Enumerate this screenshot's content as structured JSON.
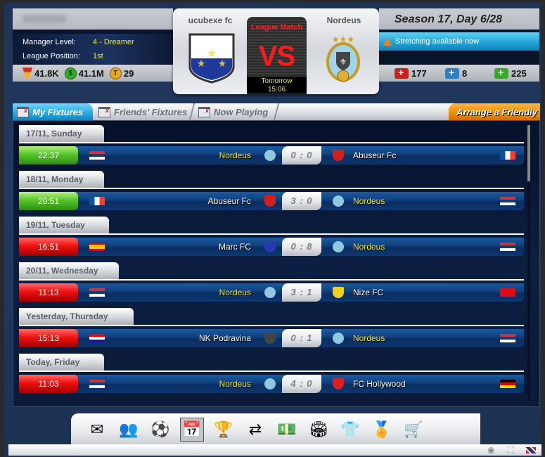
{
  "manager": {
    "name_blurred": true,
    "level_label": "Manager Level:",
    "level_value": "4 - Dreamer",
    "position_label": "League Position:",
    "position_value": "1st",
    "currencies": [
      {
        "icon": "trophy-points-icon",
        "value": "41.8K"
      },
      {
        "icon": "money-icon",
        "value": "41.1M"
      },
      {
        "icon": "token-icon",
        "value": "29"
      }
    ]
  },
  "next_match": {
    "home_team": "ucubexe fc",
    "away_team": "Nordeus",
    "type": "League Match",
    "vs": "VS",
    "day": "Tomorrow",
    "time": "15:06"
  },
  "season": {
    "label": "Season 17, Day 6/28",
    "notice": "Stretching available now",
    "kits": [
      {
        "icon": "red-medkit-icon",
        "value": "177",
        "color": "#c8201c"
      },
      {
        "icon": "blue-medkit-icon",
        "value": "8",
        "color": "#2a7fc8"
      },
      {
        "icon": "green-medkit-icon",
        "value": "225",
        "color": "#3aa72a"
      }
    ]
  },
  "tabs": [
    {
      "label": "My Fixtures",
      "active": true
    },
    {
      "label": "Friends' Fixtures",
      "active": false
    },
    {
      "label": "Now Playing",
      "active": false
    }
  ],
  "arrange_friendly": "Arrange a Friendly",
  "fixtures": [
    {
      "date": "17/11, Sunday",
      "time": "22:37",
      "result": "win",
      "home": "Nordeus",
      "home_flag": "serbia",
      "home_me": true,
      "score": "0 : 0",
      "away": "Abuseur Fc",
      "away_flag": "france",
      "away_me": false
    },
    {
      "date": "18/11, Monday",
      "time": "20:51",
      "result": "win",
      "home": "Abuseur Fc",
      "home_flag": "france",
      "home_me": false,
      "score": "3 : 0",
      "away": "Nordeus",
      "away_flag": "serbia",
      "away_me": true
    },
    {
      "date": "19/11, Tuesday",
      "time": "16:51",
      "result": "loss",
      "home": "Marc FC",
      "home_flag": "spain",
      "home_me": false,
      "score": "0 : 8",
      "away": "Nordeus",
      "away_flag": "serbia",
      "away_me": true
    },
    {
      "date": "20/11, Wednesday",
      "time": "11:13",
      "result": "loss",
      "home": "Nordeus",
      "home_flag": "serbia",
      "home_me": true,
      "score": "3 : 1",
      "away": "Nize FC",
      "away_flag": "turkey",
      "away_me": false
    },
    {
      "date": "Yesterday, Thursday",
      "time": "15:13",
      "result": "loss",
      "home": "NK Podravina",
      "home_flag": "croatia",
      "home_me": false,
      "score": "0 : 1",
      "away": "Nordeus",
      "away_flag": "serbia",
      "away_me": true
    },
    {
      "date": "Today, Friday",
      "time": "11:03",
      "result": "loss",
      "home": "Nordeus",
      "home_flag": "serbia",
      "home_me": true,
      "score": "4 : 0",
      "away": "FC Hollywood",
      "away_flag": "germany",
      "away_me": false
    }
  ],
  "dock": [
    {
      "name": "mail-icon",
      "glyph": "✉"
    },
    {
      "name": "squad-icon",
      "glyph": "👥"
    },
    {
      "name": "training-icon",
      "glyph": "⚽"
    },
    {
      "name": "fixtures-calendar-icon",
      "glyph": "📅",
      "selected": true
    },
    {
      "name": "league-podium-icon",
      "glyph": "🏆"
    },
    {
      "name": "transfers-icon",
      "glyph": "⇄"
    },
    {
      "name": "finances-icon",
      "glyph": "💵"
    },
    {
      "name": "stadium-icon",
      "glyph": "🏟"
    },
    {
      "name": "club-icon",
      "glyph": "👕"
    },
    {
      "name": "achievements-icon",
      "glyph": "🏅"
    },
    {
      "name": "shop-icon",
      "glyph": "🛒"
    }
  ]
}
